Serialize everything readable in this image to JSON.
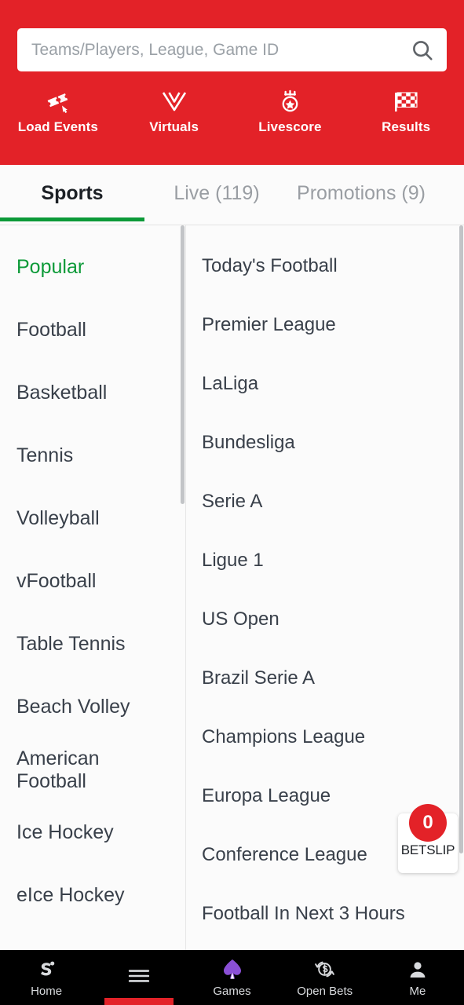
{
  "theme": {
    "brand_red": "#E32228",
    "accent_green": "#0C9A38",
    "bottom_nav_bg": "#000000",
    "games_purple": "#8A4FD6",
    "page_bg": "#FBFBFB"
  },
  "header": {
    "search": {
      "placeholder": "Teams/Players, League, Game ID",
      "value": "",
      "icon": "search-icon"
    },
    "quick_actions": [
      {
        "label": "Load Events",
        "icon": "ticket-icon"
      },
      {
        "label": "Virtuals",
        "icon": "virtuals-v-icon"
      },
      {
        "label": "Livescore",
        "icon": "medal-star-icon"
      },
      {
        "label": "Results",
        "icon": "checkered-flag-icon"
      }
    ]
  },
  "tabs": [
    {
      "label": "Sports",
      "active": true
    },
    {
      "label": "Live (119)",
      "active": false
    },
    {
      "label": "Promotions (9)",
      "active": false
    }
  ],
  "sidebar": {
    "items": [
      {
        "label": "Popular",
        "active": true
      },
      {
        "label": "Football",
        "active": false
      },
      {
        "label": "Basketball",
        "active": false
      },
      {
        "label": "Tennis",
        "active": false
      },
      {
        "label": "Volleyball",
        "active": false
      },
      {
        "label": "vFootball",
        "active": false
      },
      {
        "label": "Table Tennis",
        "active": false
      },
      {
        "label": "Beach Volley",
        "active": false
      },
      {
        "label": "American Football",
        "active": false
      },
      {
        "label": "Ice Hockey",
        "active": false
      },
      {
        "label": "eIce Hockey",
        "active": false
      }
    ]
  },
  "content": {
    "items": [
      {
        "label": "Today's Football"
      },
      {
        "label": "Premier League"
      },
      {
        "label": "LaLiga"
      },
      {
        "label": "Bundesliga"
      },
      {
        "label": "Serie A"
      },
      {
        "label": "Ligue 1"
      },
      {
        "label": "US Open"
      },
      {
        "label": "Brazil Serie A"
      },
      {
        "label": "Champions League"
      },
      {
        "label": "Europa League"
      },
      {
        "label": "Conference League"
      },
      {
        "label": "Football In Next 3 Hours"
      }
    ]
  },
  "betslip": {
    "count": "0",
    "label": "BETSLIP"
  },
  "bottom_nav": {
    "items": [
      {
        "label": "Home",
        "icon": "sporty-s-logo-icon",
        "active": false
      },
      {
        "label": "",
        "icon": "hamburger-menu-icon",
        "active": true
      },
      {
        "label": "Games",
        "icon": "spade-icon",
        "active": false
      },
      {
        "label": "Open Bets",
        "icon": "refresh-dollar-icon",
        "active": false
      },
      {
        "label": "Me",
        "icon": "person-icon",
        "active": false
      }
    ]
  }
}
